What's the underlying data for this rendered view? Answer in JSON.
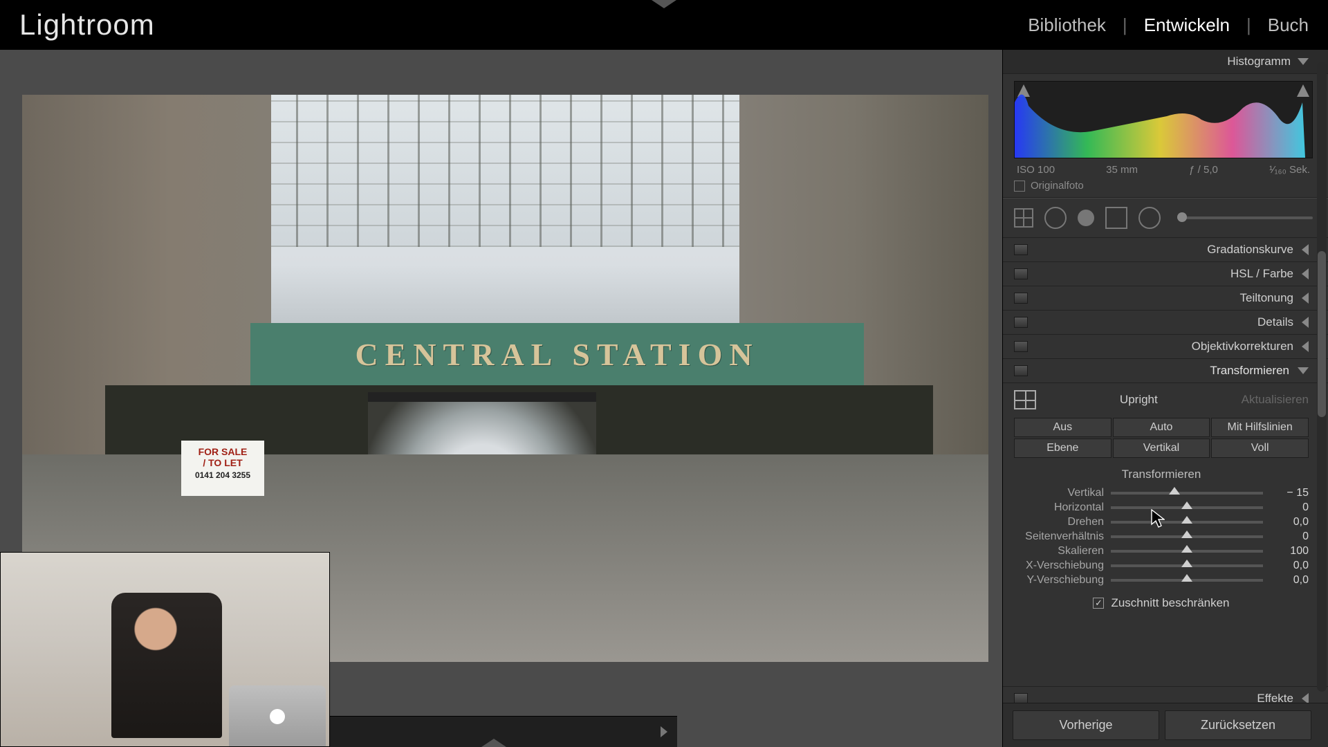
{
  "app_title": "Lightroom",
  "modules": {
    "library": "Bibliothek",
    "develop": "Entwickeln",
    "book": "Buch"
  },
  "histogram": {
    "title": "Histogramm",
    "iso": "ISO 100",
    "focal": "35 mm",
    "aperture": "ƒ / 5,0",
    "shutter": "¹⁄₁₆₀ Sek.",
    "original": "Originalfoto"
  },
  "panels": {
    "tone_curve": "Gradationskurve",
    "hsl": "HSL / Farbe",
    "split_toning": "Teiltonung",
    "details": "Details",
    "lens": "Objektivkorrekturen",
    "transform": "Transformieren",
    "effects": "Effekte"
  },
  "transform": {
    "upright": "Upright",
    "update": "Aktualisieren",
    "buttons": {
      "off": "Aus",
      "auto": "Auto",
      "guided": "Mit Hilfslinien",
      "level": "Ebene",
      "vertical": "Vertikal",
      "full": "Voll"
    },
    "section": "Transformieren",
    "sliders": {
      "vertical": {
        "label": "Vertikal",
        "value": "− 15",
        "pos": 42
      },
      "horizontal": {
        "label": "Horizontal",
        "value": "0",
        "pos": 50
      },
      "rotate": {
        "label": "Drehen",
        "value": "0,0",
        "pos": 50
      },
      "aspect": {
        "label": "Seitenverhältnis",
        "value": "0",
        "pos": 50
      },
      "scale": {
        "label": "Skalieren",
        "value": "100",
        "pos": 50
      },
      "xoffset": {
        "label": "X-Verschiebung",
        "value": "0,0",
        "pos": 50
      },
      "yoffset": {
        "label": "Y-Verschiebung",
        "value": "0,0",
        "pos": 50
      }
    },
    "constrain": "Zuschnitt beschränken"
  },
  "footer": {
    "previous": "Vorherige",
    "reset": "Zurücksetzen"
  },
  "photo": {
    "banner": "CENTRAL STATION",
    "sign_line1": "FOR SALE",
    "sign_line2": "/ TO LET",
    "sign_phone": "0141 204 3255"
  }
}
